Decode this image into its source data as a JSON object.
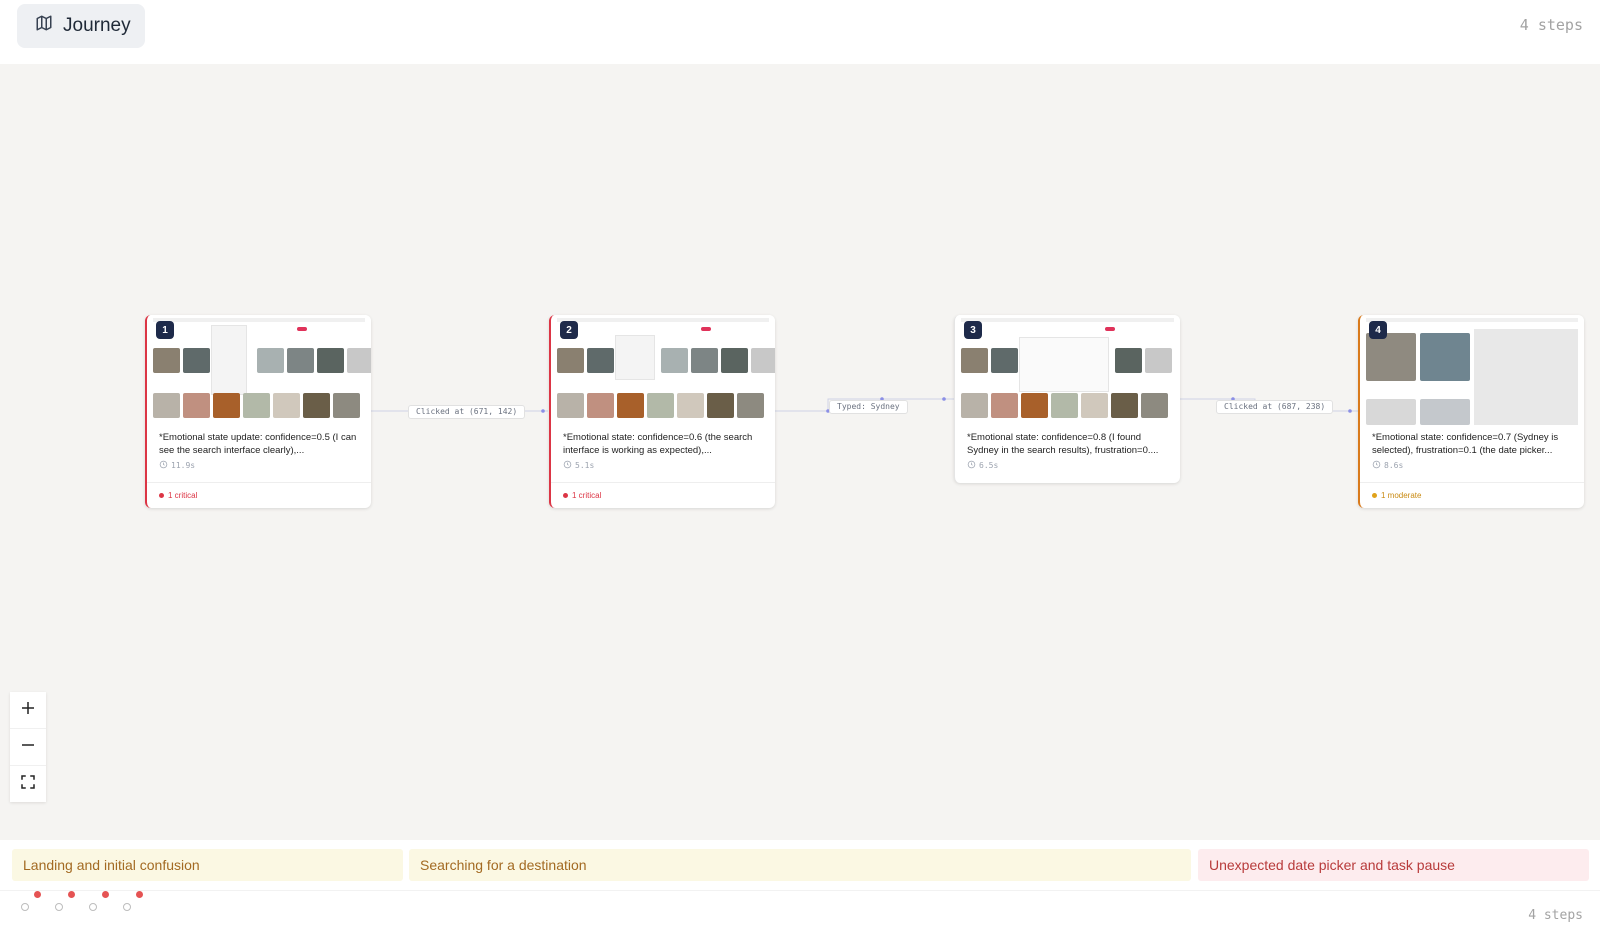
{
  "header": {
    "journey_label": "Journey",
    "steps_count": "4 steps"
  },
  "steps": [
    {
      "number": "1",
      "text": "*Emotional state update: confidence=0.5 (I can see the search interface clearly),...",
      "duration": "11.9s",
      "issue": "1 critical",
      "severity": "critical"
    },
    {
      "number": "2",
      "text": "*Emotional state: confidence=0.6 (the search interface is working as expected),...",
      "duration": "5.1s",
      "issue": "1 critical",
      "severity": "critical"
    },
    {
      "number": "3",
      "text": "*Emotional state: confidence=0.8 (I found Sydney in the search results), frustration=0....",
      "duration": "6.5s",
      "issue": "",
      "severity": "none"
    },
    {
      "number": "4",
      "text": "*Emotional state: confidence=0.7 (Sydney is selected), frustration=0.1 (the date picker...",
      "duration": "8.6s",
      "issue": "1 moderate",
      "severity": "moderate"
    }
  ],
  "edges": [
    {
      "label": "Clicked at (671, 142)"
    },
    {
      "label": "Typed: Sydney"
    },
    {
      "label": "Clicked at (687, 238)"
    }
  ],
  "phases": [
    {
      "label": "Landing and initial confusion",
      "tone": "yellow"
    },
    {
      "label": "Searching for a destination",
      "tone": "yellow"
    },
    {
      "label": "Unexpected date picker and task pause",
      "tone": "red"
    }
  ],
  "footer": {
    "steps_count": "4 steps"
  },
  "colors": {
    "critical": "#dc3545",
    "moderate": "#e0a21b",
    "badge": "#1e2a4a",
    "edge": "#8b8fe6"
  },
  "icons": {
    "journey": "map-icon",
    "duration": "clock-icon",
    "zoom_in": "plus-icon",
    "zoom_out": "minus-icon",
    "fit_view": "fullscreen-icon"
  }
}
